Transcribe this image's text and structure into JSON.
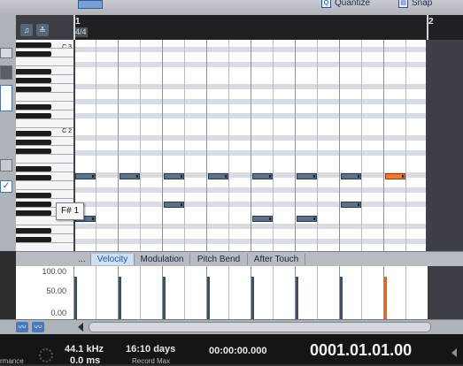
{
  "toolbar": {
    "quantize_label": "Quantize",
    "snap_label": "Snap"
  },
  "ruler": {
    "bar1": "1",
    "bar2": "2",
    "time_signature": "4/4"
  },
  "keyboard": {
    "c3_label": "C 3",
    "c2_label": "C 2"
  },
  "tooltip": {
    "note": "F# 1"
  },
  "tabs": [
    "...",
    "Velocity",
    "Modulation",
    "Pitch Bend",
    "After Touch"
  ],
  "velocity_scale": [
    "100.00",
    "50.00",
    "0.00"
  ],
  "status": {
    "sample_rate": "44.1 kHz",
    "latency": "0.0 ms",
    "record_days": "16:10 days",
    "record_label": "Record Max",
    "time_seconds": "00:00:00.000",
    "bars_position": "0001.01.01.00",
    "left_label": "rmance"
  },
  "colors": {
    "selected_note": "#f07a2a",
    "note": "#5f7186",
    "tab_active": "#1d56a8"
  },
  "notes": [
    {
      "beat": 0,
      "row": "F#1",
      "selected": false
    },
    {
      "beat": 1,
      "row": "F#1",
      "selected": false
    },
    {
      "beat": 2,
      "row": "F#1",
      "selected": false
    },
    {
      "beat": 3,
      "row": "F#1",
      "selected": false
    },
    {
      "beat": 4,
      "row": "F#1",
      "selected": false
    },
    {
      "beat": 5,
      "row": "F#1",
      "selected": false
    },
    {
      "beat": 6,
      "row": "F#1",
      "selected": false
    },
    {
      "beat": 7,
      "row": "F#1",
      "selected": true
    },
    {
      "beat": 2,
      "row": "D#1",
      "selected": false
    },
    {
      "beat": 6,
      "row": "D#1",
      "selected": false
    },
    {
      "beat": 0,
      "row": "C#1",
      "selected": false
    },
    {
      "beat": 4,
      "row": "C#1",
      "selected": false
    },
    {
      "beat": 5,
      "row": "C#1",
      "selected": false
    }
  ],
  "velocities": [
    100,
    100,
    100,
    100,
    100,
    100,
    100,
    100
  ]
}
